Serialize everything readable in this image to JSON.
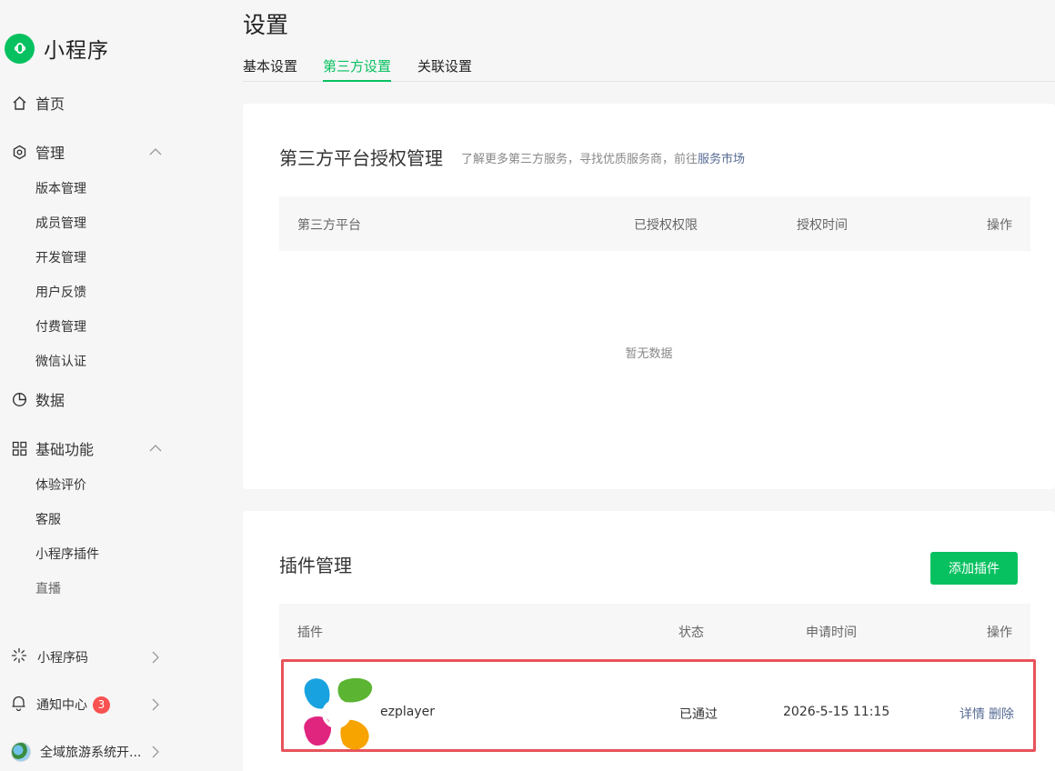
{
  "brand": {
    "name": "小程序"
  },
  "sidebar": {
    "home": "首页",
    "manage": {
      "label": "管理",
      "items": [
        "版本管理",
        "成员管理",
        "开发管理",
        "用户反馈",
        "付费管理",
        "微信认证"
      ]
    },
    "data": "数据",
    "basic": {
      "label": "基础功能",
      "items": [
        "体验评价",
        "客服",
        "小程序插件",
        "直播"
      ]
    },
    "bottom": {
      "qrcode": "小程序码",
      "notify": "通知中心",
      "notify_count": "3",
      "account": "全域旅游系统开..."
    }
  },
  "page": {
    "title": "设置",
    "tabs": [
      "基本设置",
      "第三方设置",
      "关联设置"
    ],
    "active_tab": "第三方设置"
  },
  "auth": {
    "title": "第三方平台授权管理",
    "hint": "了解更多第三方服务，寻找优质服务商，前往",
    "hint_link": "服务市场",
    "columns": [
      "第三方平台",
      "已授权权限",
      "授权时间",
      "操作"
    ],
    "empty": "暂无数据"
  },
  "plugins": {
    "title": "插件管理",
    "add_button": "添加插件",
    "columns": [
      "插件",
      "状态",
      "申请时间",
      "操作"
    ],
    "rows": [
      {
        "name": "ezplayer",
        "status": "已通过",
        "time": "2026-5-15 11:15",
        "detail": "详情",
        "delete": "删除"
      }
    ]
  },
  "colors": {
    "accent": "#07c160",
    "link": "#576b95",
    "badge": "#fa5151",
    "highlight": "#e8535a"
  }
}
